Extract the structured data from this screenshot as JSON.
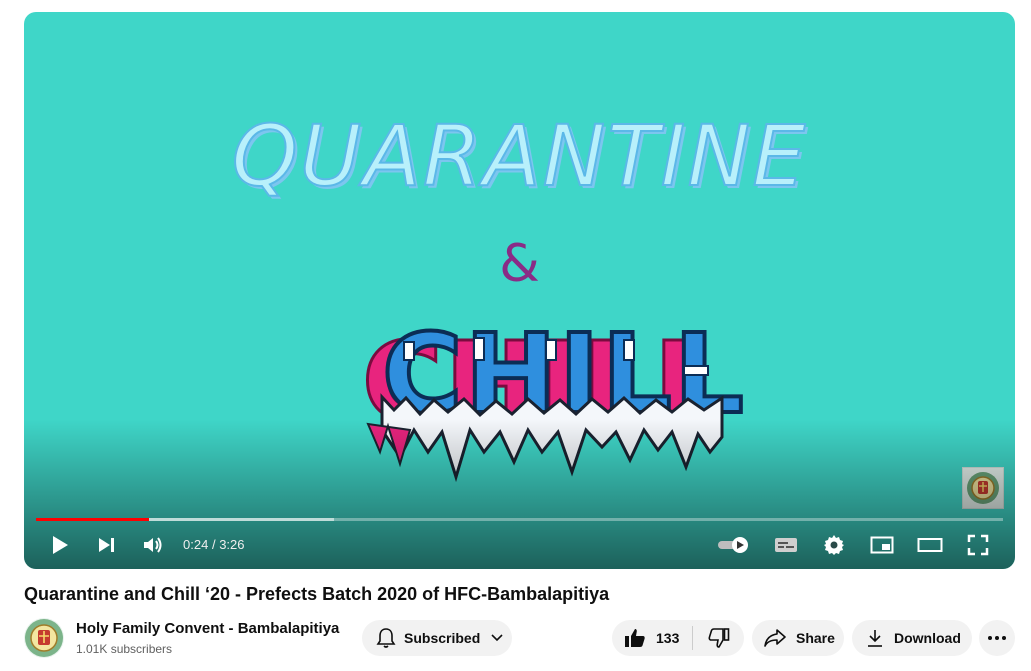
{
  "video": {
    "frame_text": {
      "line1": "QUARANTINE",
      "line2": "&",
      "line3": "CHILL"
    },
    "played_fraction": 0.117,
    "buffered_fraction": 0.308,
    "time_current": "0:24",
    "time_separator": "/",
    "time_total": "3:26"
  },
  "title": "Quarantine and Chill ‘20 - Prefects Batch 2020 of HFC-Bambalapitiya",
  "channel": {
    "name": "Holy Family Convent - Bambalapitiya",
    "subscribers": "1.01K subscribers"
  },
  "actions": {
    "subscribed_label": "Subscribed",
    "like_count": "133",
    "share_label": "Share",
    "download_label": "Download"
  },
  "colors": {
    "background_teal": "#3fd6c8",
    "progress_red": "#ff0000",
    "ampersand_purple": "#8a2c86",
    "chill_blue": "#2f8fde",
    "chill_pink": "#e8247e"
  },
  "icons": {
    "play": "play-icon",
    "next": "next-icon",
    "volume": "volume-icon",
    "autoplay": "autoplay-toggle-icon",
    "captions": "captions-icon",
    "settings": "gear-icon",
    "miniplayer": "miniplayer-icon",
    "theater": "theater-mode-icon",
    "fullscreen": "fullscreen-icon",
    "bell": "bell-icon",
    "like": "thumbs-up-icon",
    "dislike": "thumbs-down-icon",
    "share": "share-arrow-icon",
    "download": "download-icon",
    "more": "more-horizontal-icon"
  }
}
